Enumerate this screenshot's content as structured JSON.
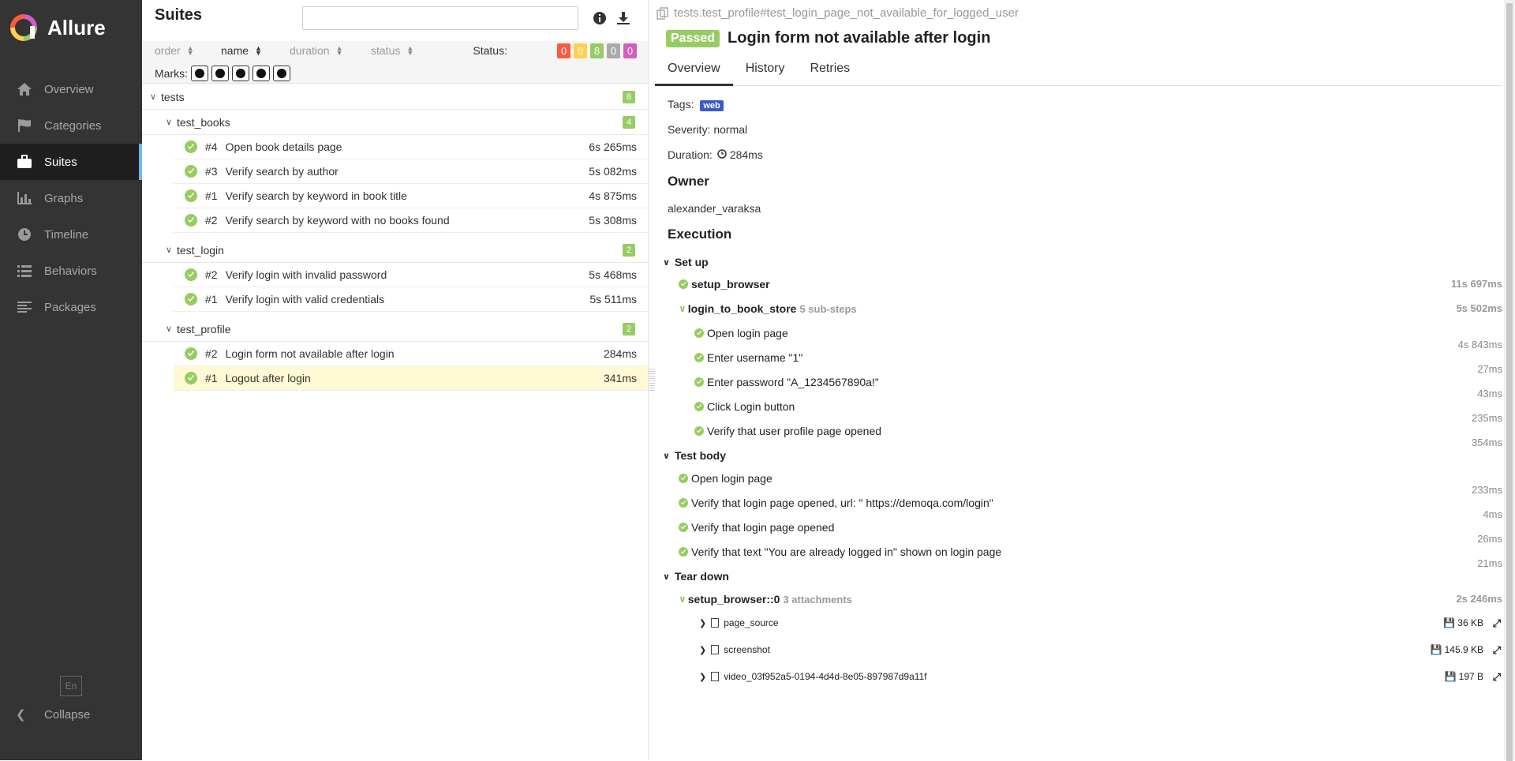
{
  "app": {
    "name": "Allure"
  },
  "sidebar": {
    "items": [
      {
        "label": "Overview",
        "icon": "home-icon"
      },
      {
        "label": "Categories",
        "icon": "flag-icon"
      },
      {
        "label": "Suites",
        "icon": "briefcase-icon",
        "active": true
      },
      {
        "label": "Graphs",
        "icon": "bar-chart-icon"
      },
      {
        "label": "Timeline",
        "icon": "clock-icon"
      },
      {
        "label": "Behaviors",
        "icon": "list-icon"
      },
      {
        "label": "Packages",
        "icon": "align-left-icon"
      }
    ],
    "language": "En",
    "collapse": "Collapse"
  },
  "suites": {
    "title": "Suites",
    "search_value": "",
    "sort": {
      "order": "order",
      "name": "name",
      "duration": "duration",
      "status": "status"
    },
    "status_label": "Status:",
    "status_counts": [
      {
        "value": "0",
        "color": "#fd5a3e"
      },
      {
        "value": "0",
        "color": "#ffd050"
      },
      {
        "value": "8",
        "color": "#97cc64"
      },
      {
        "value": "0",
        "color": "#aaaaaa"
      },
      {
        "value": "0",
        "color": "#d35ebe"
      }
    ],
    "marks_label": "Marks:",
    "root": {
      "name": "tests",
      "count": "8"
    },
    "groups": [
      {
        "name": "test_books",
        "count": "4",
        "tests": [
          {
            "num": "#4",
            "name": "Open book details page",
            "duration": "6s 265ms"
          },
          {
            "num": "#3",
            "name": "Verify search by author",
            "duration": "5s 082ms"
          },
          {
            "num": "#1",
            "name": "Verify search by keyword in book title",
            "duration": "4s 875ms"
          },
          {
            "num": "#2",
            "name": "Verify search by keyword with no books found",
            "duration": "5s 308ms"
          }
        ]
      },
      {
        "name": "test_login",
        "count": "2",
        "tests": [
          {
            "num": "#2",
            "name": "Verify login with invalid password",
            "duration": "5s 468ms"
          },
          {
            "num": "#1",
            "name": "Verify login with valid credentials",
            "duration": "5s 511ms"
          }
        ]
      },
      {
        "name": "test_profile",
        "count": "2",
        "tests": [
          {
            "num": "#2",
            "name": "Login form not available after login",
            "duration": "284ms"
          },
          {
            "num": "#1",
            "name": "Logout after login",
            "duration": "341ms"
          }
        ]
      }
    ]
  },
  "detail": {
    "breadcrumb": "tests.test_profile#test_login_page_not_available_for_logged_user",
    "status": "Passed",
    "title": "Login form not available after login",
    "tabs": [
      "Overview",
      "History",
      "Retries"
    ],
    "tags_label": "Tags:",
    "tag": "web",
    "severity": "Severity: normal",
    "duration_label": "Duration:",
    "duration": "284ms",
    "owner_title": "Owner",
    "owner": "alexander_varaksa",
    "execution_title": "Execution",
    "setup": {
      "title": "Set up",
      "steps": [
        {
          "name": "setup_browser",
          "duration": "11s 697ms"
        },
        {
          "name": "login_to_book_store",
          "extra": "5 sub-steps",
          "duration": "5s 502ms"
        }
      ],
      "substeps": [
        {
          "name": "Open login page",
          "duration": "4s 843ms"
        },
        {
          "name": "Enter username \"1\"",
          "duration": "27ms"
        },
        {
          "name": "Enter password \"A_1234567890a!\"",
          "duration": "43ms"
        },
        {
          "name": "Click Login button",
          "duration": "235ms"
        },
        {
          "name": "Verify that user profile page opened",
          "duration": "354ms"
        }
      ]
    },
    "body": {
      "title": "Test body",
      "steps": [
        {
          "name": "Open login page",
          "duration": "233ms"
        },
        {
          "name": "Verify that login page opened, url: \" https://demoqa.com/login\"",
          "duration": "4ms"
        },
        {
          "name": "Verify that login page opened",
          "duration": "26ms"
        },
        {
          "name": "Verify that text \"You are already logged in\" shown on login page",
          "duration": "21ms"
        }
      ]
    },
    "teardown": {
      "title": "Tear down",
      "step": {
        "name": "setup_browser::0",
        "extra": "3 attachments",
        "duration": "2s 246ms"
      },
      "attachments": [
        {
          "name": "page_source",
          "size": "36 KB"
        },
        {
          "name": "screenshot",
          "size": "145.9 KB"
        },
        {
          "name": "video_03f952a5-0194-4d4d-8e05-897987d9a11f",
          "size": "197 B"
        }
      ]
    }
  }
}
